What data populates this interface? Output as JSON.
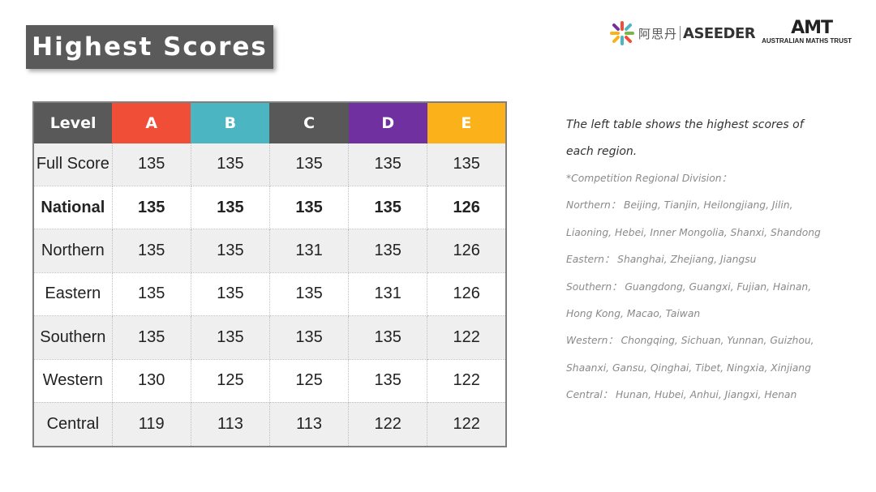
{
  "title": "Highest Scores",
  "logos": {
    "aseeder_cn": "阿思丹",
    "aseeder_en": "ASEEDER",
    "amt_short": "AMT",
    "amt_full": "AUSTRALIAN MATHS TRUST",
    "brand_colors": {
      "aseeder_red": "#d8322c",
      "amt_red": "#e0412b"
    }
  },
  "table": {
    "headers": [
      {
        "label": "Level",
        "color": "#595959"
      },
      {
        "label": "A",
        "color": "#f04e37"
      },
      {
        "label": "B",
        "color": "#4bb6c2"
      },
      {
        "label": "C",
        "color": "#585858"
      },
      {
        "label": "D",
        "color": "#7030a0"
      },
      {
        "label": "E",
        "color": "#fbb11a"
      }
    ],
    "rows": [
      {
        "label": "Full Score",
        "values": [
          "135",
          "135",
          "135",
          "135",
          "135"
        ],
        "bold": false
      },
      {
        "label": "National",
        "values": [
          "135",
          "135",
          "135",
          "135",
          "126"
        ],
        "bold": true
      },
      {
        "label": "Northern",
        "values": [
          "135",
          "135",
          "131",
          "135",
          "126"
        ],
        "bold": false
      },
      {
        "label": "Eastern",
        "values": [
          "135",
          "135",
          "135",
          "131",
          "126"
        ],
        "bold": false
      },
      {
        "label": "Southern",
        "values": [
          "135",
          "135",
          "135",
          "135",
          "122"
        ],
        "bold": false
      },
      {
        "label": "Western",
        "values": [
          "130",
          "125",
          "125",
          "135",
          "122"
        ],
        "bold": false
      },
      {
        "label": "Central",
        "values": [
          "119",
          "113",
          "113",
          "122",
          "122"
        ],
        "bold": false
      }
    ]
  },
  "description": {
    "main_line1": "The left table shows the highest scores of",
    "main_line2": "each region.",
    "notes": [
      "*Competition Regional Division：",
      "Northern： Beijing, Tianjin, Heilongjiang, Jilin,",
      "Liaoning, Hebei, Inner Mongolia, Shanxi, Shandong",
      " Eastern： Shanghai, Zhejiang, Jiangsu",
      "Southern： Guangdong, Guangxi, Fujian, Hainan,",
      "Hong Kong, Macao, Taiwan",
      "Western： Chongqing, Sichuan, Yunnan, Guizhou,",
      "Shaanxi, Gansu, Qinghai, Tibet, Ningxia, Xinjiang",
      "Central： Hunan, Hubei, Anhui, Jiangxi, Henan"
    ]
  }
}
